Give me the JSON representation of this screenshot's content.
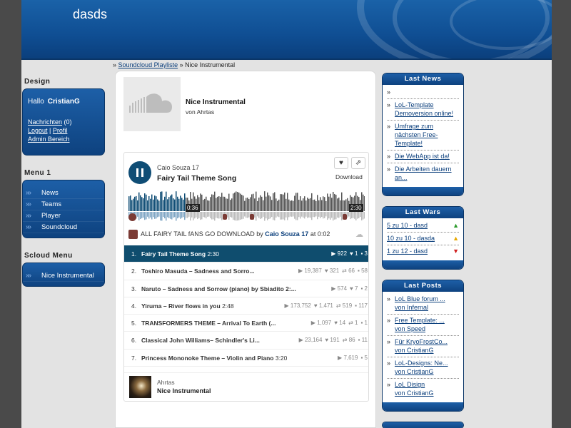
{
  "site": {
    "title": "dasds"
  },
  "breadcrumb": {
    "sep1": "»",
    "link": "Soundcloud Playliste",
    "sep2": "»",
    "current": "Nice Instrumental"
  },
  "left": {
    "design_heading": "Design",
    "hello": "Hallo",
    "username": "CristianG",
    "messages_label": "Nachrichten",
    "messages_count": "(0)",
    "logout": "Logout",
    "pipe": "|",
    "profile": "Profil",
    "admin": "Admin Bereich",
    "menu1_heading": "Menu 1",
    "menu1": [
      {
        "label": "News"
      },
      {
        "label": "Teams"
      },
      {
        "label": "Player"
      },
      {
        "label": "Soundcloud"
      }
    ],
    "scloud_heading": "Scloud Menu",
    "scloud": [
      {
        "label": "Nice Instrumental"
      }
    ]
  },
  "track": {
    "title": "Nice Instrumental",
    "by": "von Ahrtas"
  },
  "player": {
    "user": "Caio Souza 17",
    "song": "Fairy Tail Theme Song",
    "download": "Download",
    "time_current": "0:36",
    "time_total": "2:30",
    "progress": 0.24,
    "comment": {
      "text": "ALL FAIRY TAIL fANS GO DOWNLOAD",
      "by_label": "by",
      "author": "Caio Souza 17",
      "at_label": "at",
      "time": "0:02"
    },
    "tracks": [
      {
        "num": "1.",
        "title": "Fairy Tail Theme Song",
        "dur": "2:30",
        "plays": "922",
        "likes": "1",
        "reposts": "",
        "comments": "3"
      },
      {
        "num": "2.",
        "title": "Toshiro Masuda – Sadness and Sorro...",
        "dur": "",
        "plays": "19,387",
        "likes": "321",
        "reposts": "66",
        "comments": "58"
      },
      {
        "num": "3.",
        "title": "Naruto – Sadness and Sorrow (piano) by Sbiadito 2:...",
        "dur": "",
        "plays": "574",
        "likes": "7",
        "reposts": "",
        "comments": "2"
      },
      {
        "num": "4.",
        "title": "Yiruma – River flows in you",
        "dur": "2:48",
        "plays": "173,752",
        "likes": "1,471",
        "reposts": "519",
        "comments": "117"
      },
      {
        "num": "5.",
        "title": "TRANSFORMERS THEME – Arrival To Earth (...",
        "dur": "",
        "plays": "1,097",
        "likes": "14",
        "reposts": "1",
        "comments": "1"
      },
      {
        "num": "6.",
        "title": "Classical John Williams– Schindler's Li...",
        "dur": "",
        "plays": "23,164",
        "likes": "191",
        "reposts": "86",
        "comments": "11"
      },
      {
        "num": "7.",
        "title": "Princess Mononoke Theme – Violin and Piano",
        "dur": "3:20",
        "plays": "7,619",
        "likes": "",
        "reposts": "",
        "comments": "5"
      }
    ],
    "now_artist": "Ahrtas",
    "now_title": "Nice Instrumental"
  },
  "right": {
    "news_heading": "Last News",
    "news": [
      {
        "text": ""
      },
      {
        "text": "LoL-Template Demoversion online!"
      },
      {
        "text": "Umfrage zum nächsten Free-Template!"
      },
      {
        "text": "Die WebApp ist da!"
      },
      {
        "text": "Die Arbeiten dauern an..."
      }
    ],
    "wars_heading": "Last Wars",
    "wars": [
      {
        "text": "5 zu 10 - dasd",
        "arrow": "▲",
        "color": "#2a9a2a"
      },
      {
        "text": "10 zu 10 - dasda",
        "arrow": "▲",
        "color": "#e8a800"
      },
      {
        "text": "1 zu 12 - dasd",
        "arrow": "▼",
        "color": "#d02020"
      }
    ],
    "posts_heading": "Last Posts",
    "posts": [
      {
        "title": "LoL Blue forum ...",
        "by": "von Infernal"
      },
      {
        "title": "Free Template: ...",
        "by": "von Speed"
      },
      {
        "title": "Für KryoFrostCo...",
        "by": "von CristianG"
      },
      {
        "title": "LoL-Designs: Ne...",
        "by": "von CristianG"
      },
      {
        "title": "LoL Disign",
        "by": "von CristianG"
      }
    ]
  }
}
